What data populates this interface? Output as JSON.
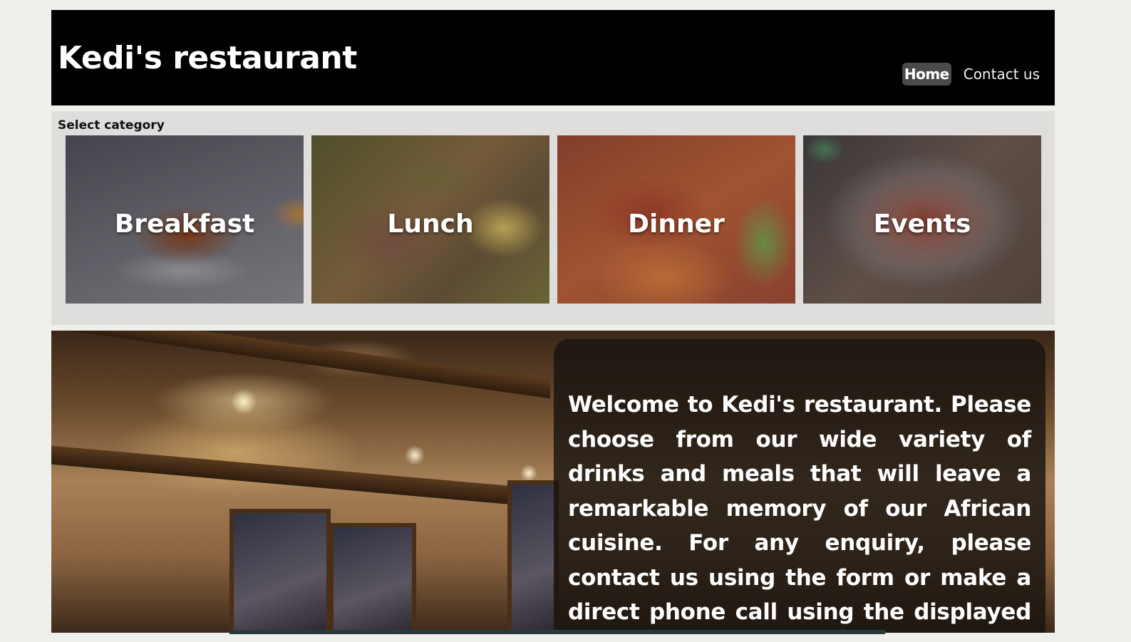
{
  "header": {
    "title": "Kedi's restaurant",
    "nav": [
      {
        "label": "Home",
        "active": true
      },
      {
        "label": "Contact us",
        "active": false
      }
    ]
  },
  "categories": {
    "heading": "Select category",
    "items": [
      {
        "label": "Breakfast"
      },
      {
        "label": "Lunch"
      },
      {
        "label": "Dinner"
      },
      {
        "label": "Events"
      }
    ]
  },
  "hero": {
    "welcome": "Welcome to Kedi's restaurant. Please choose from our wide variety of drinks and meals that will leave a remarkable memory of our African cuisine. For any enquiry, please contact us using the form or make a direct phone call using the displayed phone number."
  },
  "colors": {
    "header_bg": "#000000",
    "page_bg": "#efefec",
    "panel_bg": "#dfdedc",
    "active_nav_bg": "#4a4a4a"
  }
}
